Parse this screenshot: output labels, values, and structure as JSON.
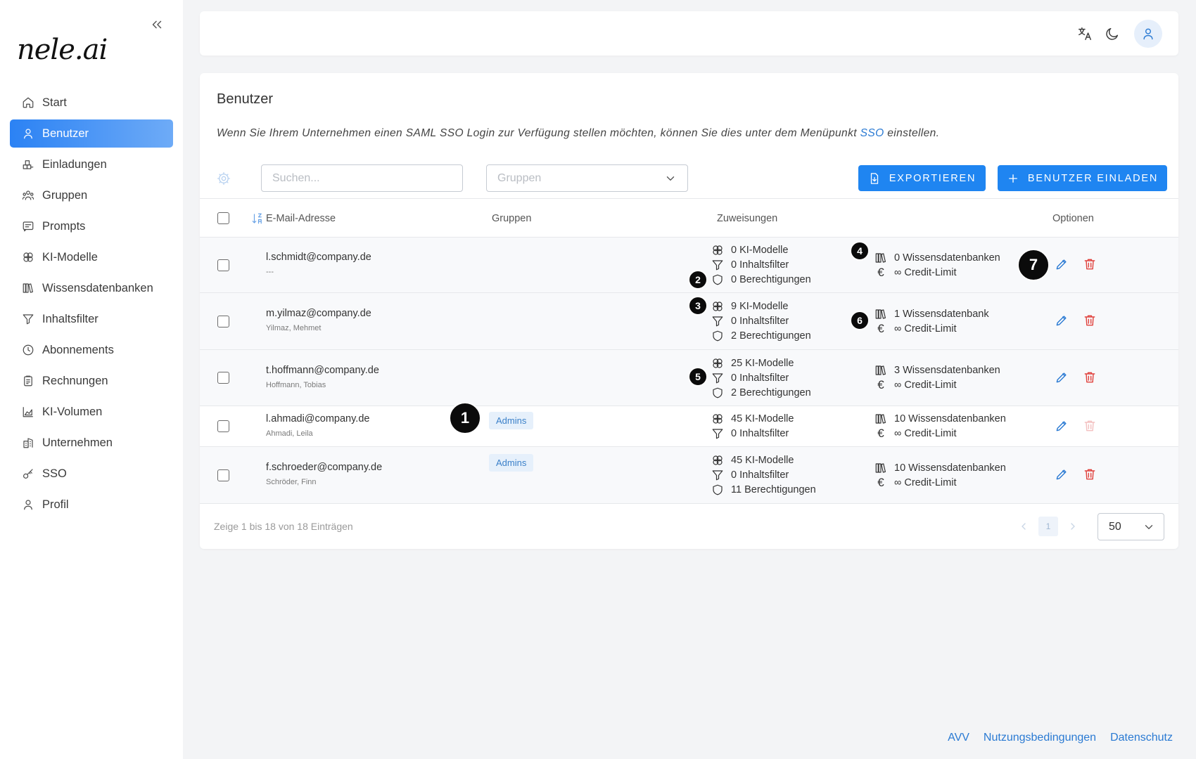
{
  "app": {
    "logo_text": "nele.ai"
  },
  "sidebar": {
    "collapse_icon": "chevrons-left-icon",
    "items": [
      {
        "label": "Start",
        "icon": "home-icon"
      },
      {
        "label": "Benutzer",
        "icon": "user-icon",
        "active": true
      },
      {
        "label": "Einladungen",
        "icon": "boxes-icon"
      },
      {
        "label": "Gruppen",
        "icon": "group-icon"
      },
      {
        "label": "Prompts",
        "icon": "message-text-icon"
      },
      {
        "label": "KI-Modelle",
        "icon": "model-circles-icon"
      },
      {
        "label": "Wissensdatenbanken",
        "icon": "library-icon"
      },
      {
        "label": "Inhaltsfilter",
        "icon": "funnel-icon"
      },
      {
        "label": "Abonnements",
        "icon": "clock-icon"
      },
      {
        "label": "Rechnungen",
        "icon": "receipt-icon"
      },
      {
        "label": "KI-Volumen",
        "icon": "area-chart-icon"
      },
      {
        "label": "Unternehmen",
        "icon": "building-icon"
      },
      {
        "label": "SSO",
        "icon": "key-icon"
      },
      {
        "label": "Profil",
        "icon": "user-icon"
      }
    ]
  },
  "header": {
    "icons": [
      "translate-icon",
      "moon-icon",
      "user-avatar-icon"
    ]
  },
  "page": {
    "title": "Benutzer",
    "description_pre": "Wenn Sie Ihrem Unternehmen einen SAML SSO Login zur Verfügung stellen möchten, können Sie dies unter dem Menüpunkt ",
    "description_link": "SSO",
    "description_post": " einstellen."
  },
  "toolbar": {
    "search_placeholder": "Suchen...",
    "groups_placeholder": "Gruppen",
    "export_label": "EXPORTIEREN",
    "invite_label": "BENUTZER EINLADEN"
  },
  "table": {
    "headers": {
      "email": "E-Mail-Adresse",
      "groups": "Gruppen",
      "assignments": "Zuweisungen",
      "options": "Optionen"
    },
    "rows": [
      {
        "email": "l.schmidt@company.de",
        "name": "---",
        "group": "",
        "models": "0 KI-Modelle",
        "filters": "0 Inhaltsfilter",
        "permissions": "0 Berechtigungen",
        "knowledge": "0 Wissensdatenbanken",
        "credit": "∞ Credit-Limit",
        "delete_disabled": false
      },
      {
        "email": "m.yilmaz@company.de",
        "name": "Yilmaz, Mehmet",
        "group": "",
        "models": "9 KI-Modelle",
        "filters": "0 Inhaltsfilter",
        "permissions": "2 Berechtigungen",
        "knowledge": "1 Wissensdatenbank",
        "credit": "∞ Credit-Limit",
        "delete_disabled": false
      },
      {
        "email": "t.hoffmann@company.de",
        "name": "Hoffmann, Tobias",
        "group": "",
        "models": "25 KI-Modelle",
        "filters": "0 Inhaltsfilter",
        "permissions": "2 Berechtigungen",
        "knowledge": "3 Wissensdatenbanken",
        "credit": "∞ Credit-Limit",
        "delete_disabled": false
      },
      {
        "email": "l.ahmadi@company.de",
        "name": "Ahmadi, Leila",
        "group": "Admins",
        "models": "45 KI-Modelle",
        "filters": "0 Inhaltsfilter",
        "permissions": "",
        "knowledge": "10 Wissensdatenbanken",
        "credit": "∞ Credit-Limit",
        "delete_disabled": true
      },
      {
        "email": "f.schroeder@company.de",
        "name": "Schröder, Finn",
        "group": "Admins",
        "models": "45 KI-Modelle",
        "filters": "0 Inhaltsfilter",
        "permissions": "11 Berechtigungen",
        "knowledge": "10 Wissensdatenbanken",
        "credit": "∞ Credit-Limit",
        "delete_disabled": false
      }
    ]
  },
  "footer": {
    "summary": "Zeige 1 bis 18 von 18 Einträgen",
    "current_page": "1",
    "page_size": "50"
  },
  "links": [
    "AVV",
    "Nutzungsbedingungen",
    "Datenschutz"
  ],
  "annotations": [
    "1",
    "2",
    "3",
    "4",
    "5",
    "6",
    "7"
  ],
  "colors": {
    "accent": "#1f85f1",
    "link": "#2a7ad3",
    "danger": "#e0413c",
    "background": "#f3f4f6",
    "badge_bg": "#e6f0fb"
  }
}
